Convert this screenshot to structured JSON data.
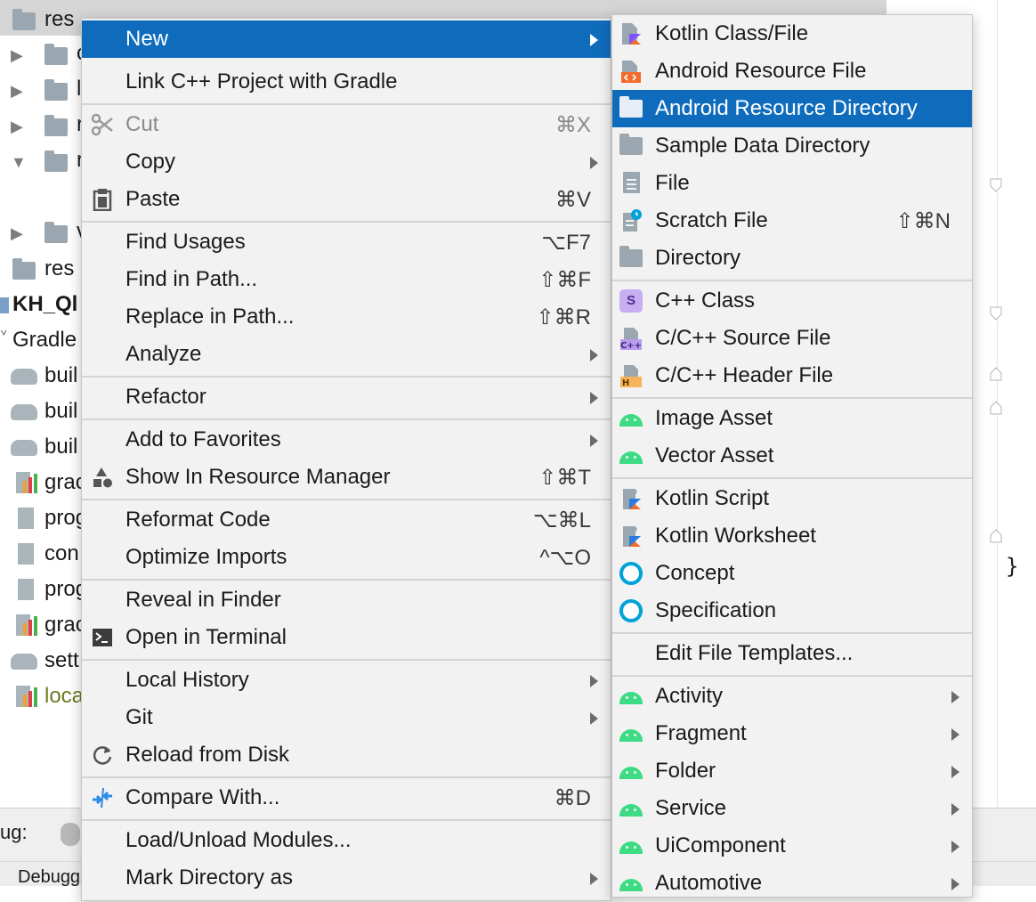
{
  "tree": {
    "rows": [
      {
        "label": "res",
        "style": "selected"
      },
      {
        "label": "c"
      },
      {
        "label": "l"
      },
      {
        "label": "r"
      },
      {
        "label": "r"
      },
      {
        "label": "v"
      },
      {
        "label": "res"
      },
      {
        "label": "KH_Ql",
        "style": "bold"
      },
      {
        "label": "Gradle"
      },
      {
        "label": "buil"
      },
      {
        "label": "buil"
      },
      {
        "label": "buil"
      },
      {
        "label": "grac"
      },
      {
        "label": "prog"
      },
      {
        "label": "con"
      },
      {
        "label": "prog"
      },
      {
        "label": "grac"
      },
      {
        "label": "sett"
      },
      {
        "label": "loca"
      }
    ],
    "bottom_label": "ug:",
    "bottom_tab": "Debugg"
  },
  "editor": {
    "brace": "}"
  },
  "context_menu": {
    "items": [
      {
        "label": "New",
        "shortcut": "",
        "submenu": true,
        "icon": "",
        "state": "selected"
      },
      {
        "label": "Link C++ Project with Gradle",
        "shortcut": "",
        "submenu": false,
        "icon": ""
      },
      {
        "label": "Cut",
        "shortcut": "⌘X",
        "submenu": false,
        "icon": "scissors-icon",
        "state": "disabled"
      },
      {
        "label": "Copy",
        "shortcut": "",
        "submenu": true,
        "icon": ""
      },
      {
        "label": "Paste",
        "shortcut": "⌘V",
        "submenu": false,
        "icon": "clipboard-icon"
      },
      {
        "label": "Find Usages",
        "shortcut": "⌥F7",
        "submenu": false,
        "icon": ""
      },
      {
        "label": "Find in Path...",
        "shortcut": "⇧⌘F",
        "submenu": false,
        "icon": ""
      },
      {
        "label": "Replace in Path...",
        "shortcut": "⇧⌘R",
        "submenu": false,
        "icon": ""
      },
      {
        "label": "Analyze",
        "shortcut": "",
        "submenu": true,
        "icon": ""
      },
      {
        "label": "Refactor",
        "shortcut": "",
        "submenu": true,
        "icon": ""
      },
      {
        "label": "Add to Favorites",
        "shortcut": "",
        "submenu": true,
        "icon": ""
      },
      {
        "label": "Show In Resource Manager",
        "shortcut": "⇧⌘T",
        "submenu": false,
        "icon": "resource-manager-icon"
      },
      {
        "label": "Reformat Code",
        "shortcut": "⌥⌘L",
        "submenu": false,
        "icon": ""
      },
      {
        "label": "Optimize Imports",
        "shortcut": "^⌥O",
        "submenu": false,
        "icon": ""
      },
      {
        "label": "Reveal in Finder",
        "shortcut": "",
        "submenu": false,
        "icon": ""
      },
      {
        "label": "Open in Terminal",
        "shortcut": "",
        "submenu": false,
        "icon": "terminal-icon"
      },
      {
        "label": "Local History",
        "shortcut": "",
        "submenu": true,
        "icon": ""
      },
      {
        "label": "Git",
        "shortcut": "",
        "submenu": true,
        "icon": ""
      },
      {
        "label": "Reload from Disk",
        "shortcut": "",
        "submenu": false,
        "icon": "reload-icon"
      },
      {
        "label": "Compare With...",
        "shortcut": "⌘D",
        "submenu": false,
        "icon": "compare-icon"
      },
      {
        "label": "Load/Unload Modules...",
        "shortcut": "",
        "submenu": false,
        "icon": ""
      },
      {
        "label": "Mark Directory as",
        "shortcut": "",
        "submenu": true,
        "icon": ""
      }
    ]
  },
  "new_submenu": {
    "items": [
      {
        "label": "Kotlin Class/File",
        "shortcut": "",
        "submenu": false,
        "icon": "kotlin-file-icon"
      },
      {
        "label": "Android Resource File",
        "shortcut": "",
        "submenu": false,
        "icon": "android-resource-file-icon"
      },
      {
        "label": "Android Resource Directory",
        "shortcut": "",
        "submenu": false,
        "icon": "folder-icon",
        "state": "selected"
      },
      {
        "label": "Sample Data Directory",
        "shortcut": "",
        "submenu": false,
        "icon": "folder-icon"
      },
      {
        "label": "File",
        "shortcut": "",
        "submenu": false,
        "icon": "file-icon"
      },
      {
        "label": "Scratch File",
        "shortcut": "⇧⌘N",
        "submenu": false,
        "icon": "scratch-file-icon"
      },
      {
        "label": "Directory",
        "shortcut": "",
        "submenu": false,
        "icon": "folder-icon"
      },
      {
        "label": "C++ Class",
        "shortcut": "",
        "submenu": false,
        "icon": "cpp-class-icon"
      },
      {
        "label": "C/C++ Source File",
        "shortcut": "",
        "submenu": false,
        "icon": "cpp-source-file-icon"
      },
      {
        "label": "C/C++ Header File",
        "shortcut": "",
        "submenu": false,
        "icon": "cpp-header-file-icon"
      },
      {
        "label": "Image Asset",
        "shortcut": "",
        "submenu": false,
        "icon": "android-icon"
      },
      {
        "label": "Vector Asset",
        "shortcut": "",
        "submenu": false,
        "icon": "android-icon"
      },
      {
        "label": "Kotlin Script",
        "shortcut": "",
        "submenu": false,
        "icon": "kotlin-script-icon"
      },
      {
        "label": "Kotlin Worksheet",
        "shortcut": "",
        "submenu": false,
        "icon": "kotlin-script-icon"
      },
      {
        "label": "Concept",
        "shortcut": "",
        "submenu": false,
        "icon": "concept-icon"
      },
      {
        "label": "Specification",
        "shortcut": "",
        "submenu": false,
        "icon": "concept-icon"
      },
      {
        "label": "Edit File Templates...",
        "shortcut": "",
        "submenu": false,
        "icon": ""
      },
      {
        "label": "Activity",
        "shortcut": "",
        "submenu": true,
        "icon": "android-icon"
      },
      {
        "label": "Fragment",
        "shortcut": "",
        "submenu": true,
        "icon": "android-icon"
      },
      {
        "label": "Folder",
        "shortcut": "",
        "submenu": true,
        "icon": "android-icon"
      },
      {
        "label": "Service",
        "shortcut": "",
        "submenu": true,
        "icon": "android-icon"
      },
      {
        "label": "UiComponent",
        "shortcut": "",
        "submenu": true,
        "icon": "android-icon"
      },
      {
        "label": "Automotive",
        "shortcut": "",
        "submenu": true,
        "icon": "android-icon"
      }
    ]
  },
  "colors": {
    "selection": "#0f6cbd",
    "menu_background": "#f2f2f2",
    "android_green": "#3ddc84",
    "folder_gray": "#9aa7b0"
  }
}
